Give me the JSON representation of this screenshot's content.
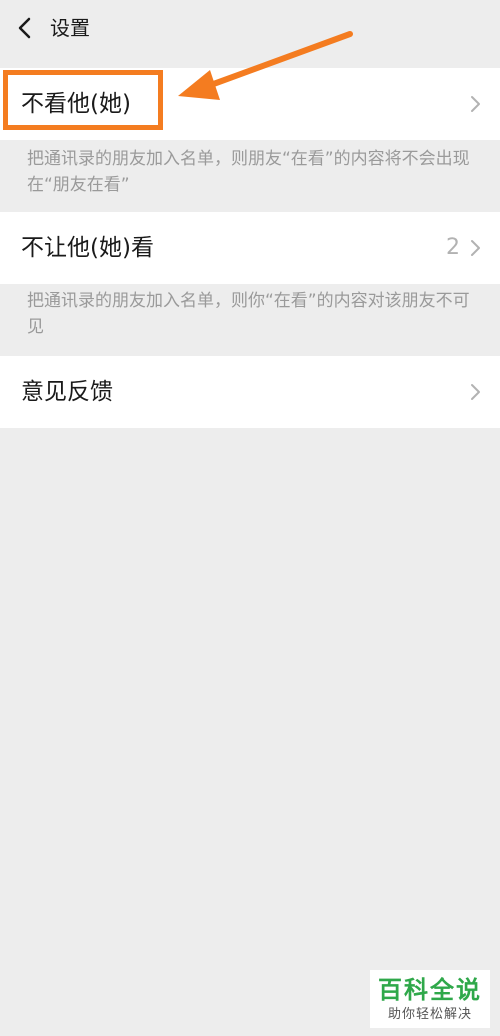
{
  "header": {
    "title": "设置"
  },
  "rows": [
    {
      "label": "不看他(她)",
      "description": "把通讯录的朋友加入名单，则朋友“在看”的内容将不会出现在“朋友在看”"
    },
    {
      "label": "不让他(她)看",
      "count": "2",
      "description": "把通讯录的朋友加入名单，则你“在看”的内容对该朋友不可见"
    },
    {
      "label": "意见反馈"
    }
  ],
  "watermark": {
    "main": "百科全说",
    "sub": "助你轻松解决"
  },
  "colors": {
    "highlight": "#f47c20",
    "watermark_green": "#2fa84a",
    "background": "#ededed"
  }
}
